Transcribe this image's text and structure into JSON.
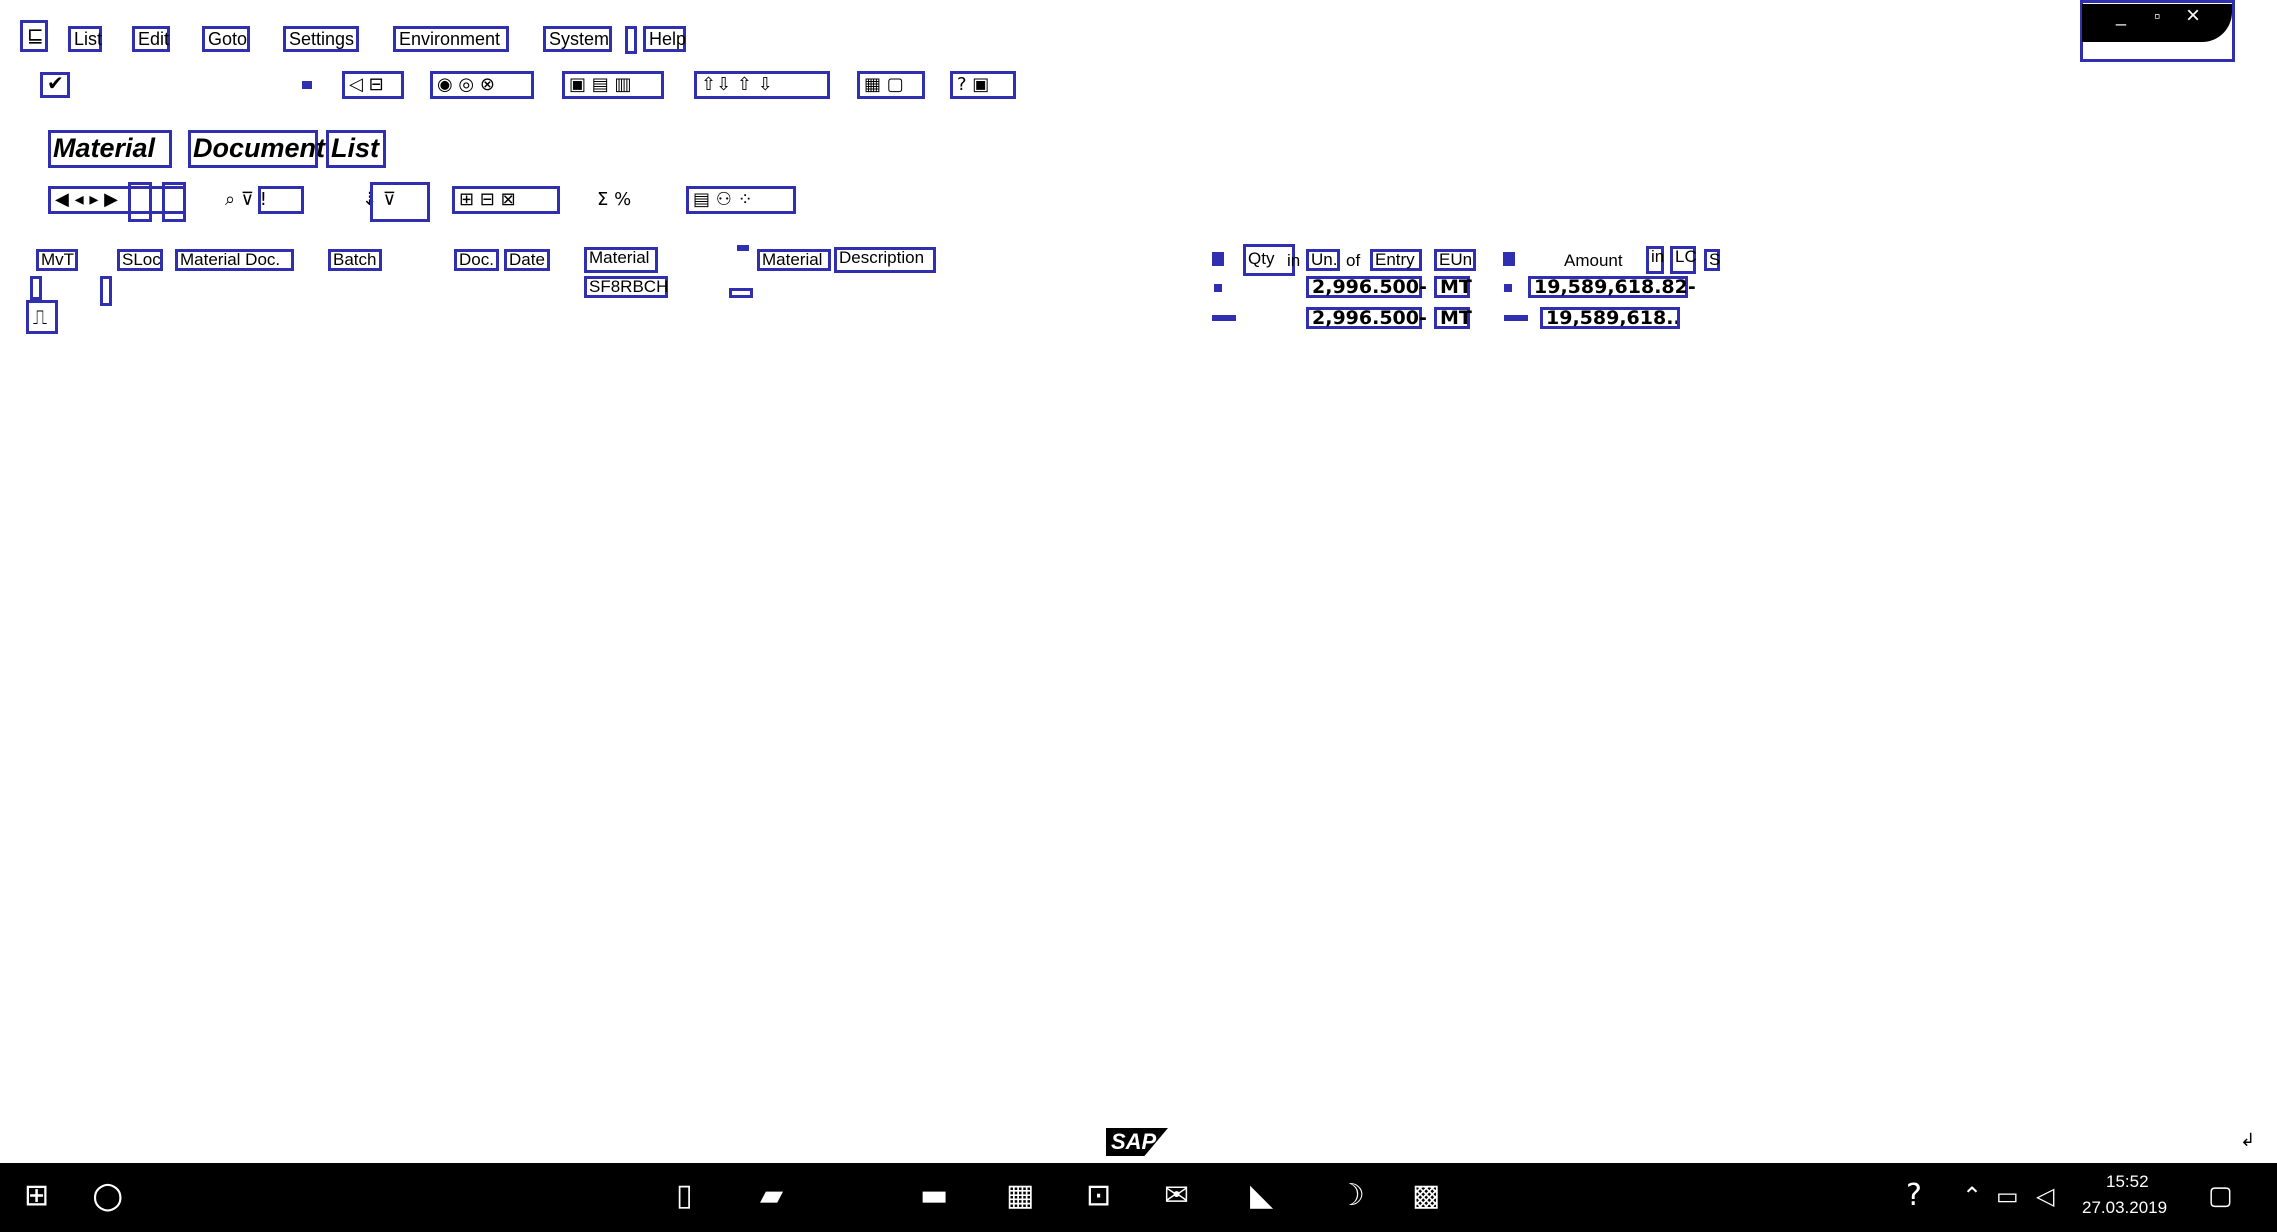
{
  "menu": {
    "items": [
      "List",
      "Edit",
      "Goto",
      "Settings",
      "Environment",
      "System",
      "Help"
    ]
  },
  "window_controls": {
    "minimize": "_",
    "restore": "▫",
    "close": "×"
  },
  "toolbar": {
    "glyphs_nav": "◁ ⊟",
    "glyphs_actions": "◉ ◎ ⊗",
    "glyphs_print": "▣ ▤ ▥",
    "glyphs_find": "⇧⇩ ⇧ ⇩",
    "glyphs_layout": "▦ ▢",
    "glyphs_help": "? ▣"
  },
  "title": {
    "word1": "Material",
    "word2": "Document",
    "word3": "List"
  },
  "app_toolbar": {
    "nav": "◀ ◂ ▸ ▶",
    "filter": "⌕ ⊽ !",
    "sort": "⇣ ⊽",
    "details": "⊞ ⊟ ⊠",
    "sum": "Σ %",
    "export": "▤ ⚇ ⁘"
  },
  "table": {
    "headers": {
      "mvt": "MvT",
      "sloc": "SLoc",
      "material_doc": "Material Doc.",
      "batch": "Batch",
      "doc": "Doc.",
      "date": "Date",
      "material": "Material",
      "material_label": "Material",
      "description": "Description",
      "qty": "Qty",
      "qty_suffix": "in",
      "un": "Un.",
      "of": "of",
      "entry": "Entry",
      "eun": "EUn",
      "amount": "Amount",
      "amount_in": "in",
      "lc": "LC",
      "s": "S"
    },
    "rows": [
      {
        "material": "SF8RBCH",
        "qty": "2,996.500-",
        "eun": "MT",
        "amount": "19,589,618.82-"
      },
      {
        "qty": "2,996.500-",
        "eun": "MT",
        "amount": "19,589,618..."
      }
    ]
  },
  "footer": {
    "logo": "SAP"
  },
  "taskbar": {
    "start": "⊞",
    "search": "○",
    "clock_time": "15:52",
    "clock_date": "27.03.2019"
  }
}
